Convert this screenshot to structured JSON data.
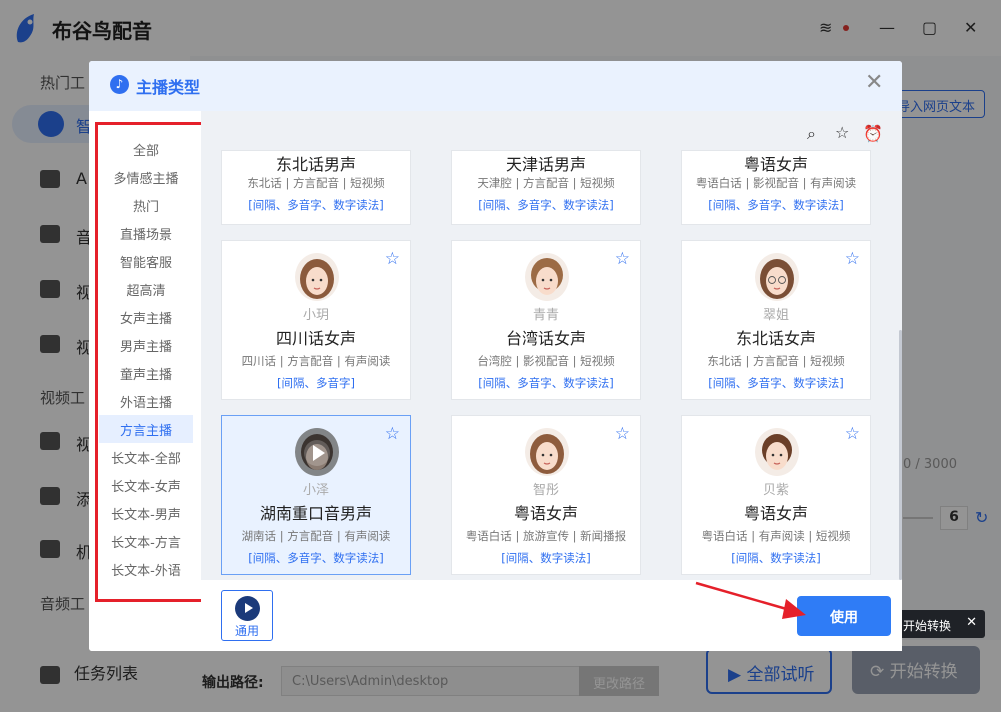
{
  "app": {
    "name": "布谷鸟配音",
    "window_controls": [
      "layers-icon",
      "minimize",
      "maximize",
      "close"
    ]
  },
  "sidebar": {
    "section_hot": "热门工",
    "active_item": "智",
    "items": [
      {
        "label": "A",
        "icon": "person-icon"
      },
      {
        "label": "音",
        "icon": "audio-icon"
      },
      {
        "label": "视",
        "icon": "video-icon"
      },
      {
        "label": "视",
        "icon": "video2-icon"
      }
    ],
    "section_video": "视频工",
    "items2": [
      {
        "label": "视",
        "icon": "video-edit-icon"
      },
      {
        "label": "添",
        "icon": "add-icon"
      },
      {
        "label": "机",
        "icon": "robot-icon"
      }
    ],
    "section_audio": "音频工",
    "task_list": "任务列表"
  },
  "main": {
    "import_web_text": "导入网页文本",
    "char_counter": "0 / 3000",
    "speed_value": "6",
    "tooltip_text": "开始转换",
    "output_path_label": "输出路径:",
    "output_path_value": "C:\\Users\\Admin\\desktop",
    "change_path_button": "更改路径",
    "listen_all_button": "全部试听",
    "start_button": "开始转换"
  },
  "modal": {
    "title": "主播类型",
    "categories": [
      "全部",
      "多情感主播",
      "热门",
      "直播场景",
      "智能客服",
      "超高清",
      "女声主播",
      "男声主播",
      "童声主播",
      "外语主播",
      "方言主播",
      "长文本-全部",
      "长文本-女声",
      "长文本-男声",
      "长文本-方言",
      "长文本-外语"
    ],
    "active_category": "方言主播",
    "tools": [
      "search-icon",
      "star-icon",
      "clock-icon"
    ],
    "top_cards": [
      {
        "voice": "东北话男声",
        "tags": "东北话 | 方言配音 | 短视频",
        "features": "[间隔、多音字、数字读法]"
      },
      {
        "voice": "天津话男声",
        "tags": "天津腔 | 方言配音 | 短视频",
        "features": "[间隔、多音字、数字读法]"
      },
      {
        "voice": "粤语女声",
        "tags": "粤语白话 | 影视配音 | 有声阅读",
        "features": "[间隔、多音字、数字读法]"
      }
    ],
    "cards": [
      {
        "nick": "小玥",
        "voice": "四川话女声",
        "tags": "四川话 | 方言配音 | 有声阅读",
        "features": "[间隔、多音字]",
        "avatar": "female"
      },
      {
        "nick": "青青",
        "voice": "台湾话女声",
        "tags": "台湾腔 | 影视配音 | 短视频",
        "features": "[间隔、多音字、数字读法]",
        "avatar": "female"
      },
      {
        "nick": "翠姐",
        "voice": "东北话女声",
        "tags": "东北话 | 方言配音 | 短视频",
        "features": "[间隔、多音字、数字读法]",
        "avatar": "female"
      },
      {
        "nick": "小泽",
        "voice": "湖南重口音男声",
        "tags": "湖南话 | 方言配音 | 有声阅读",
        "features": "[间隔、多音字、数字读法]",
        "avatar": "male",
        "selected": true
      },
      {
        "nick": "智彤",
        "voice": "粤语女声",
        "tags": "粤语白话 | 旅游宣传 | 新闻播报",
        "features": "[间隔、数字读法]",
        "avatar": "female"
      },
      {
        "nick": "贝紫",
        "voice": "粤语女声",
        "tags": "粤语白话 | 有声阅读 | 短视频",
        "features": "[间隔、数字读法]",
        "avatar": "female"
      }
    ],
    "general_button": "通用",
    "use_button": "使用"
  },
  "colors": {
    "accent": "#2f6ff0",
    "highlight_box": "#e5202a",
    "annotation_arrow": "#e5202a"
  }
}
